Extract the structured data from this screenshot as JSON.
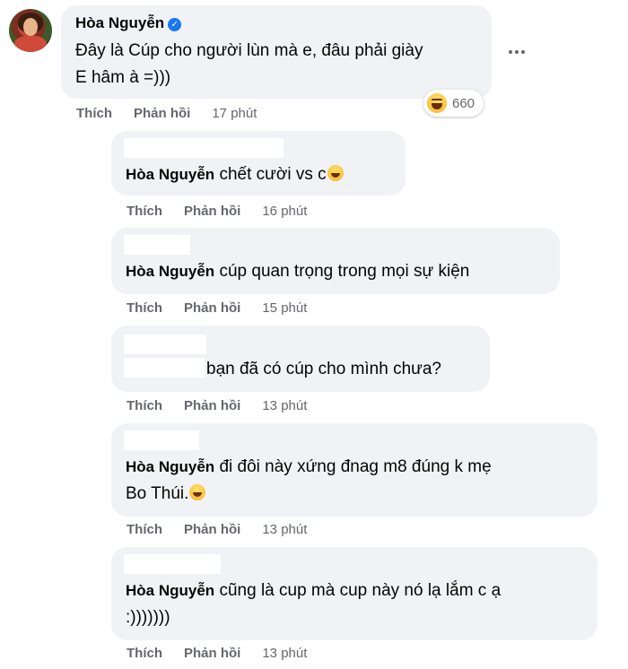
{
  "main_comment": {
    "author": "Hòa Nguyễn",
    "line1": "Đây là Cúp cho người lùn mà e, đâu phải giày",
    "line2": "E hâm à =)))",
    "like": "Thích",
    "reply": "Phản hồi",
    "time": "17 phút",
    "reaction_count": "660",
    "reaction_icon": "haha-emoji-icon",
    "more_icon": "more-options-icon"
  },
  "replies": [
    {
      "author": "Hòa Nguyễn",
      "text": "chết cười vs c",
      "emoji": "laugh-tears-emoji-icon",
      "like": "Thích",
      "reply": "Phản hồi",
      "time": "16 phút"
    },
    {
      "author": "Hòa Nguyễn",
      "text": "cúp quan trọng trong mọi sự kiện",
      "like": "Thích",
      "reply": "Phản hồi",
      "time": "15 phút"
    },
    {
      "author": "",
      "text": "bạn đã có cúp cho mình chưa?",
      "like": "Thích",
      "reply": "Phản hồi",
      "time": "13 phút"
    },
    {
      "author": "Hòa Nguyễn",
      "text_line1": "đi đôi này xứng đnag m8 đúng k mẹ",
      "text_line2": "Bo Thúi.",
      "emoji": "rofl-emoji-icon",
      "like": "Thích",
      "reply": "Phản hồi",
      "time": "13 phút"
    },
    {
      "author": "Hòa Nguyễn",
      "text_line1": "cũng là cup mà cup này nó lạ lắm c ạ",
      "text_line2": ":)))))))",
      "like": "Thích",
      "reply": "Phản hồi",
      "time": "13 phút"
    }
  ]
}
